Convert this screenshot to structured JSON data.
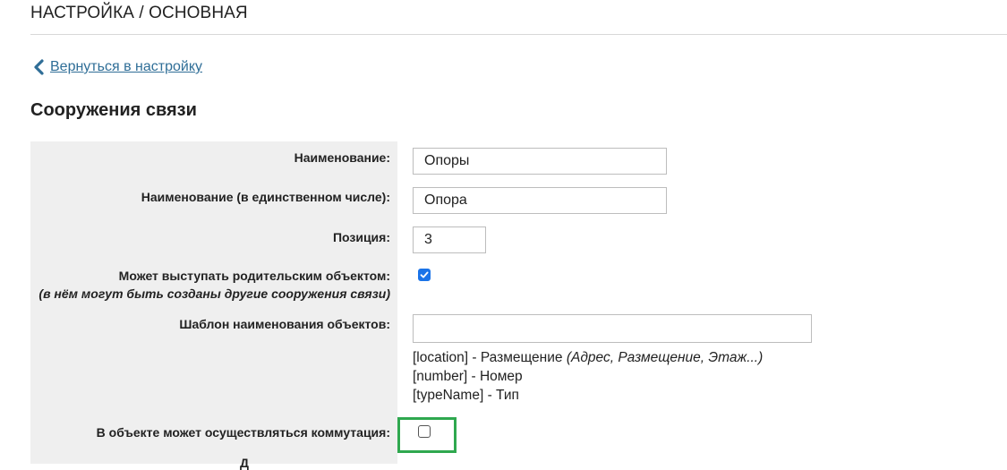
{
  "header": {
    "title": "НАСТРОЙКА / ОСНОВНАЯ"
  },
  "nav": {
    "back_label": "Вернуться в настройку"
  },
  "section": {
    "title": "Сооружения связи"
  },
  "form": {
    "name_label": "Наименование:",
    "name_value": "Опоры",
    "singular_label": "Наименование (в единственном числе):",
    "singular_value": "Опора",
    "position_label": "Позиция:",
    "position_value": "3",
    "parent_label": "Может выступать родительским объектом:",
    "parent_note": "(в нём могут быть созданы другие сооружения связи)",
    "parent_checked": true,
    "template_label": "Шаблон наименования объектов:",
    "template_value": "",
    "hints": [
      {
        "code": "[location]",
        "text": " - Размещение ",
        "note": "(Адрес, Размещение, Этаж...)"
      },
      {
        "code": "[number]",
        "text": " - Номер",
        "note": ""
      },
      {
        "code": "[typeName]",
        "text": " - Тип",
        "note": ""
      }
    ],
    "switching_label": "В объекте может осуществляться коммутация:",
    "switching_checked": false,
    "cut_label": "Д"
  },
  "colors": {
    "link": "#2f6e97",
    "checkbox_accent": "#1a73e8",
    "highlight": "#2fa84f",
    "panel_bg": "#efefef"
  }
}
